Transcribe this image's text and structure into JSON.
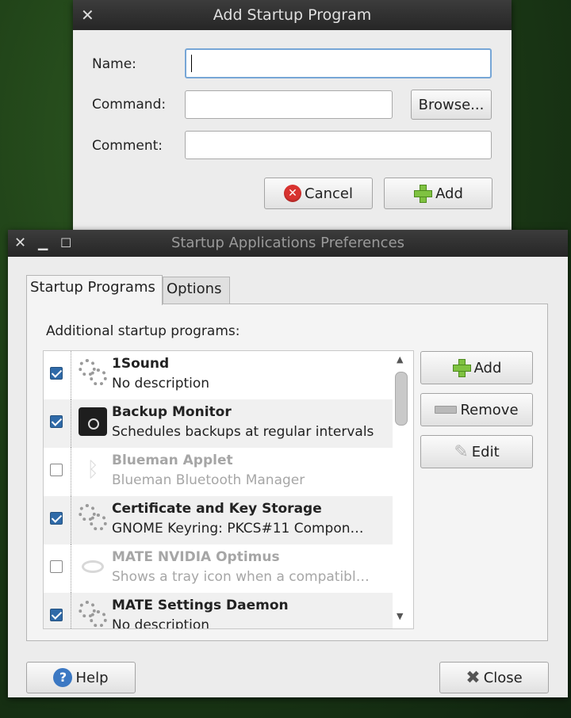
{
  "add_dialog": {
    "title": "Add Startup Program",
    "name_label": "Name:",
    "name_value": "",
    "command_label": "Command:",
    "command_value": "",
    "browse_label": "Browse...",
    "comment_label": "Comment:",
    "comment_value": "",
    "cancel_label": "Cancel",
    "add_label": "Add"
  },
  "prefs_window": {
    "title": "Startup Applications Preferences",
    "tabs": [
      {
        "label": "Startup Programs",
        "active": true
      },
      {
        "label": "Options",
        "active": false
      }
    ],
    "section_label": "Additional startup programs:",
    "programs": [
      {
        "name": "1Sound",
        "description": "No description",
        "enabled": true,
        "icon": "gears-icon"
      },
      {
        "name": "Backup Monitor",
        "description": "Schedules backups at regular intervals",
        "enabled": true,
        "icon": "backup-disk-icon"
      },
      {
        "name": "Blueman Applet",
        "description": "Blueman Bluetooth Manager",
        "enabled": false,
        "icon": "bluetooth-icon"
      },
      {
        "name": "Certificate and Key Storage",
        "description": "GNOME Keyring: PKCS#11 Compon…",
        "enabled": true,
        "icon": "gears-icon"
      },
      {
        "name": "MATE NVIDIA Optimus",
        "description": "Shows a tray icon when a compatibl…",
        "enabled": false,
        "icon": "nvidia-icon"
      },
      {
        "name": "MATE Settings Daemon",
        "description": "No description",
        "enabled": true,
        "icon": "gears-icon"
      }
    ],
    "add_label": "Add",
    "remove_label": "Remove",
    "edit_label": "Edit",
    "help_label": "Help",
    "close_label": "Close"
  }
}
